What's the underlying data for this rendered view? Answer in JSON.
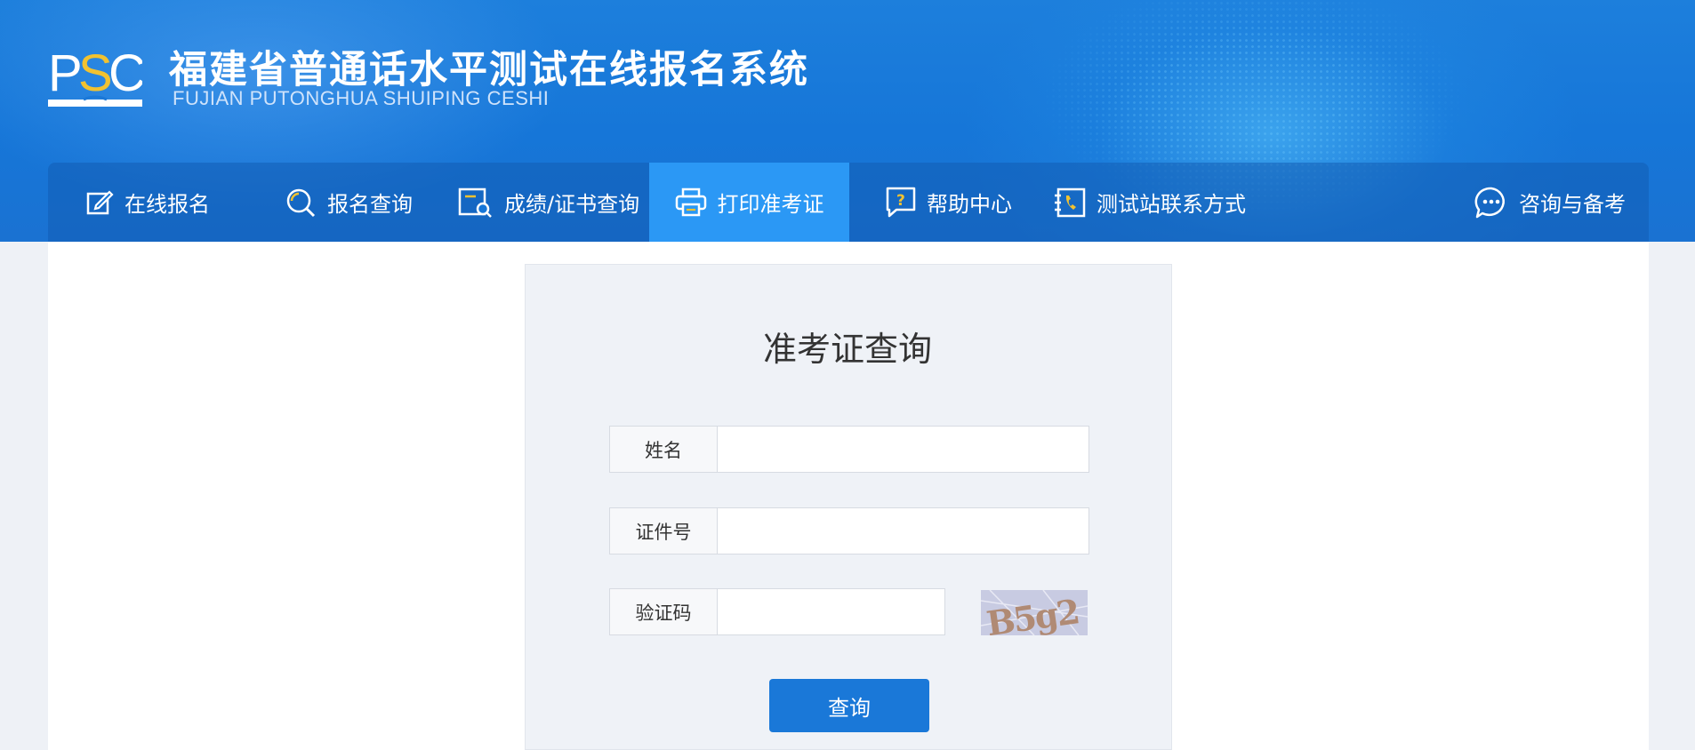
{
  "header": {
    "logo_text": "PSC",
    "title": "福建省普通话水平测试在线报名系统",
    "subtitle": "FUJIAN PUTONGHUA SHUIPING CESHI"
  },
  "nav": {
    "items": [
      {
        "label": "在线报名",
        "icon": "edit-icon"
      },
      {
        "label": "报名查询",
        "icon": "search-icon"
      },
      {
        "label": "成绩/证书查询",
        "icon": "document-search-icon"
      },
      {
        "label": "打印准考证",
        "icon": "printer-icon",
        "active": true
      },
      {
        "label": "帮助中心",
        "icon": "help-icon"
      },
      {
        "label": "测试站联系方式",
        "icon": "phone-book-icon"
      },
      {
        "label": "咨询与备考",
        "icon": "chat-icon"
      }
    ]
  },
  "form": {
    "title": "准考证查询",
    "name_label": "姓名",
    "name_value": "",
    "id_label": "证件号",
    "id_value": "",
    "captcha_label": "验证码",
    "captcha_value": "",
    "captcha_text": "B5g2",
    "submit_label": "查询"
  },
  "colors": {
    "banner": "#1a78d8",
    "nav_active": "#2b98f5",
    "button": "#1a78d8",
    "logo_accent": "#f2c230"
  }
}
